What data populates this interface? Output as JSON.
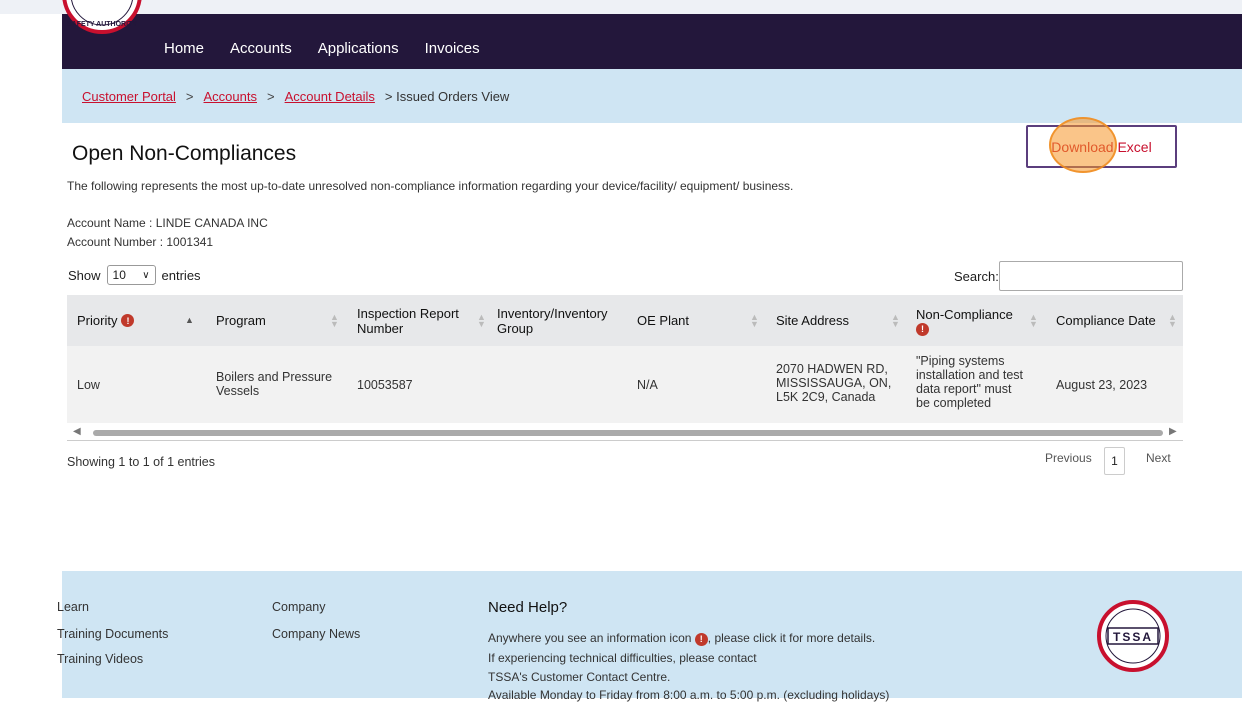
{
  "nav": {
    "items": [
      "Home",
      "Accounts",
      "Applications",
      "Invoices"
    ]
  },
  "logo": {
    "text": "SAFETY AUTHORITY"
  },
  "breadcrumb": {
    "portal": "Customer Portal",
    "accounts": "Accounts",
    "details": "Account Details",
    "sep": ">",
    "current": "> Issued Orders View"
  },
  "page": {
    "title": "Open Non-Compliances",
    "description": "The following represents the most up-to-date unresolved non-compliance information regarding your device/facility/ equipment/ business.",
    "account_name": "Account Name :   LINDE CANADA INC",
    "account_number": "Account Number : 1001341",
    "download_label": "Download Excel"
  },
  "table_controls": {
    "show": "Show",
    "entries_value": "10",
    "entries": "entries",
    "search_label": "Search:",
    "search_value": ""
  },
  "table": {
    "headers": {
      "priority": "Priority",
      "program": "Program",
      "inspection1": "Inspection Report",
      "inspection2": "Number",
      "inventory1": "Inventory/Inventory",
      "inventory2": "Group",
      "oe_plant": "OE Plant",
      "site": "Site Address",
      "noncompliance": "Non-Compliance",
      "date": "Compliance Date"
    },
    "row": {
      "priority": "Low",
      "program1": "Boilers and Pressure",
      "program2": "Vessels",
      "inspection": "10053587",
      "inventory": "",
      "oe_plant": "N/A",
      "site1": "2070 HADWEN RD,",
      "site2": "MISSISSAUGA, ON,",
      "site3": "L5K 2C9, Canada",
      "nc1": "\"Piping systems",
      "nc2": "installation and test",
      "nc3": "data report\" must",
      "nc4": "be completed",
      "date": "August 23, 2023"
    }
  },
  "pagination": {
    "summary": "Showing 1 to 1 of 1 entries",
    "previous": "Previous",
    "page": "1",
    "next": "Next"
  },
  "footer": {
    "learn": "Learn",
    "training_docs": "Training Documents",
    "training_videos": "Training Videos",
    "company": "Company",
    "company_news": "Company News",
    "help_title": "Need Help?",
    "help1a": "Anywhere you see an information icon",
    "help1b": ", please click it for more details.",
    "help2": "If experiencing technical difficulties, please contact",
    "help3": "TSSA's Customer Contact Centre.",
    "help4": "Available Monday to Friday from 8:00 a.m. to 5:00 p.m. (excluding holidays)",
    "logo_text": "TSSA"
  },
  "colors": {
    "navbar": "#23173b",
    "accent": "#c8102e",
    "light_blue": "#cfe5f3"
  }
}
